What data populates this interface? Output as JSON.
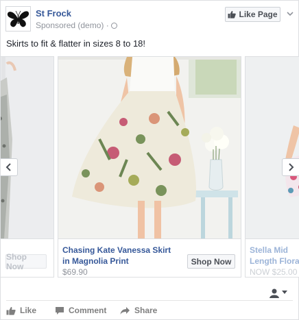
{
  "header": {
    "page_name": "St Frock",
    "sponsored_label": "Sponsored (demo) ·",
    "like_page_label": "Like Page"
  },
  "post": {
    "text": "Skirts to fit & flatter in sizes 8 to 18!"
  },
  "carousel": {
    "cards": [
      {
        "title": "",
        "price": "",
        "cta": "Shop Now"
      },
      {
        "title": "Chasing Kate Vanessa Skirt in Magnolia Print",
        "price": "$69.90",
        "cta": "Shop Now"
      },
      {
        "title": "Stella Mid Length Floral",
        "price": "NOW $25.00",
        "cta": ""
      }
    ]
  },
  "actions": {
    "like": "Like",
    "comment": "Comment",
    "share": "Share"
  },
  "colors": {
    "link": "#365899",
    "muted": "#90949c",
    "border": "#dddfe2"
  }
}
